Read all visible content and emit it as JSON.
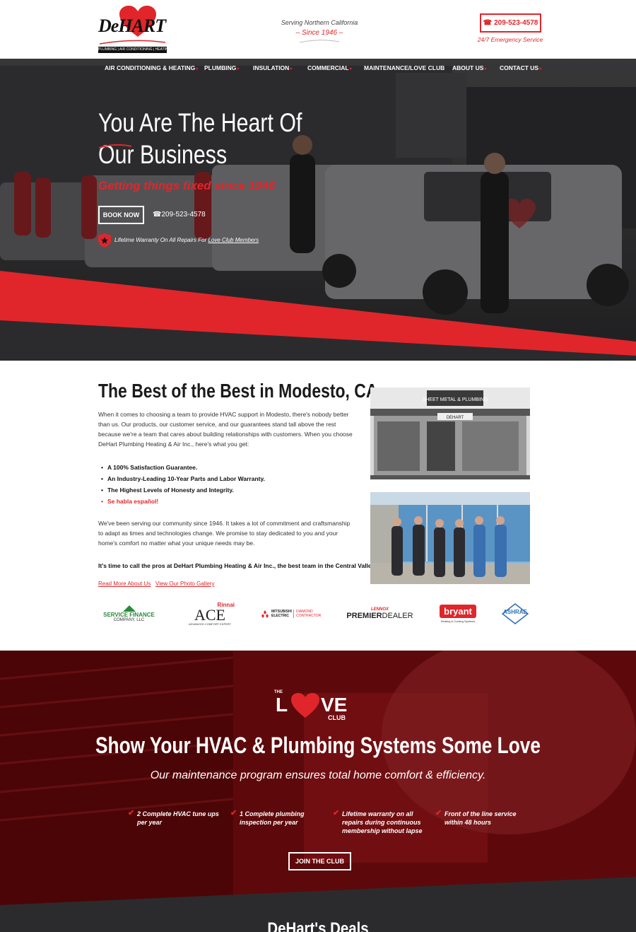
{
  "header": {
    "logo_word": "DeHART",
    "logo_tagline": "PLUMBING | AIR CONDITIONING | HEATING",
    "serving_line1": "Serving Northern California",
    "serving_line2": "– Since 1946 –",
    "phone": "209-523-4578",
    "emergency": "24/7 Emergency Service"
  },
  "nav": {
    "items": [
      {
        "label": "AIR CONDITIONING & HEATING",
        "has_dropdown": true
      },
      {
        "label": "PLUMBING",
        "has_dropdown": true
      },
      {
        "label": "INSULATION",
        "has_dropdown": true
      },
      {
        "label": "COMMERCIAL",
        "has_dropdown": true
      },
      {
        "label": "MAINTENANCE/LOVE CLUB",
        "has_dropdown": false
      },
      {
        "label": "ABOUT US",
        "has_dropdown": true
      },
      {
        "label": "CONTACT US",
        "has_dropdown": true
      }
    ]
  },
  "hero": {
    "title_line1": "You Are The Heart Of",
    "title_line2": "Our Business",
    "subtitle": "Getting things fixed since 1946",
    "book_label": "BOOK NOW",
    "phone": "209-523-4578",
    "warranty_text": "Lifetime Warranty On All Repairs For ",
    "warranty_link": "Love Club Members"
  },
  "intro": {
    "title": "The Best of the Best in Modesto, CA",
    "paragraph1": "When it comes to choosing a team to provide HVAC support in Modesto, there's nobody better than us. Our products, our customer service, and our guarantees stand tall above the rest because we're a team that cares about building relationships with customers. When you choose DeHart Plumbing Heating & Air Inc., here's what you get:",
    "bullets": [
      "A 100% Satisfaction Guarantee.",
      "An Industry-Leading 10-Year Parts and Labor Warranty.",
      "The Highest Levels of Honesty and Integrity.",
      "Se habla español!"
    ],
    "paragraph2": "We've been serving our community since 1946. It takes a lot of commitment and craftsmanship to adapt as times and technologies change. We promise to stay dedicated to you and your home's comfort no matter what your unique needs may be.",
    "cta": "It's time to call the pros at DeHart Plumbing Heating & Air Inc., the best team in the Central Valley.",
    "link_about": "Read More About Us",
    "link_gallery": "View Our Photo Gallery",
    "photo_sign": "SHEET METAL & PLUMBING",
    "photo_storefront": "DEHART"
  },
  "partners": {
    "service_finance_1": "SERVICE FINANCE",
    "service_finance_2": "COMPANY, LLC",
    "rinnai_brand": "Rinnai",
    "rinnai_ace": "ACE",
    "rinnai_sub": "ADVANCED COMFORT EXPERT",
    "mitsubishi": "MITSUBISHI ELECTRIC",
    "diamond": "DIAMOND CONTRACTOR",
    "lennox": "LENNOX",
    "premier_a": "PREMIER",
    "premier_b": "DEALER",
    "bryant": "bryant",
    "bryant_sub": "Heating & Cooling Systems",
    "ashrae": "ASHRAE"
  },
  "love_club": {
    "logo_the": "THE",
    "logo_l": "L",
    "logo_ve": "VE",
    "logo_club": "CLUB",
    "title": "Show Your HVAC & Plumbing Systems Some Love",
    "subtitle": "Our maintenance program ensures total home comfort & efficiency.",
    "benefits": [
      "2 Complete HVAC tune ups per year",
      "1 Complete plumbing inspection per year",
      "Lifetime warranty on all repairs during continuous membership without lapse",
      "Front of the line service within 48 hours"
    ],
    "join_label": "JOIN THE CLUB"
  },
  "deals": {
    "title": "DeHart's Deals"
  },
  "colors": {
    "brand_red": "#e0262b",
    "dark": "#2b2b2d",
    "love_bg": "#7a0d10"
  }
}
